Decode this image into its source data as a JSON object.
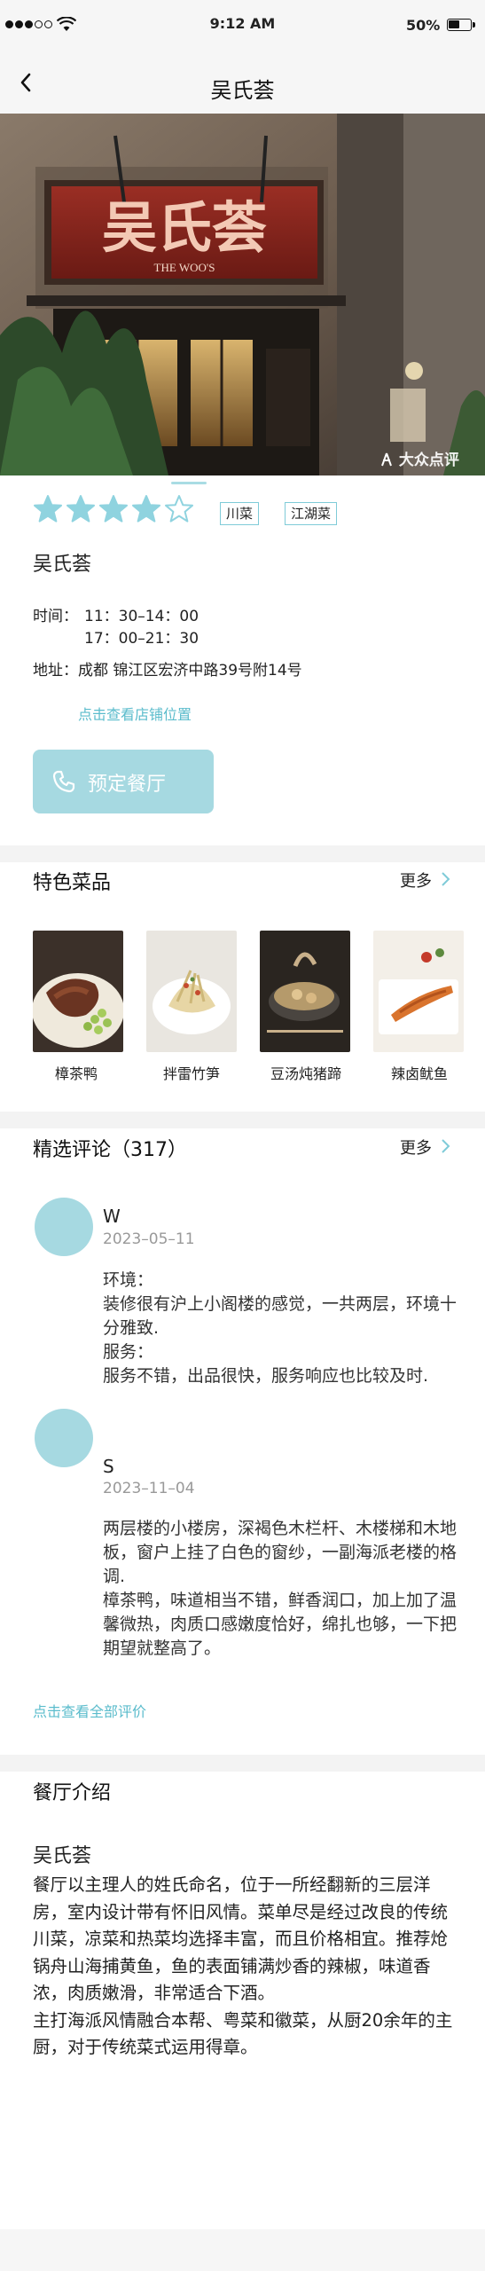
{
  "status_bar": {
    "time": "9:12 AM",
    "battery_percent": "50%",
    "battery_level": 0.5,
    "signal_bars_filled": 3,
    "signal_bars_total": 5
  },
  "nav": {
    "title": "吴氏荟",
    "back_icon": "chevron-left-icon"
  },
  "hero": {
    "watermark": "大众点评",
    "sign_text": "吴氏荟",
    "sign_sub": "THE WOO'S"
  },
  "rating": {
    "stars": 4,
    "max": 5,
    "color": "#8fd3df"
  },
  "tags": [
    "川菜",
    "江湖菜"
  ],
  "shop": {
    "name": "吴氏荟",
    "hours_label": "时间：",
    "hours": [
      "11：30–14：00",
      "17：00–21：30"
    ],
    "address_label": "地址：",
    "address": "成都 锦江区宏济中路39号附14号",
    "map_link": "点击查看店铺位置",
    "reserve_label": "预定餐厅"
  },
  "dishes": {
    "title": "特色菜品",
    "more": "更多",
    "items": [
      {
        "name": "樟茶鸭"
      },
      {
        "name": "拌雷竹笋"
      },
      {
        "name": "豆汤炖猪蹄"
      },
      {
        "name": "辣卤鱿鱼"
      }
    ]
  },
  "reviews": {
    "title": "精选评论（317）",
    "more": "更多",
    "items": [
      {
        "name": "W",
        "date": "2023–05–11",
        "lines": [
          "环境：",
          "装修很有沪上小阁楼的感觉，一共两层，环境十分雅致.",
          "服务：",
          "服务不错，出品很快，服务响应也比较及时."
        ]
      },
      {
        "name": "S",
        "date": "2023–11–04",
        "lines": [
          "两层楼的小楼房，深褐色木栏杆、木楼梯和木地板，窗户上挂了白色的窗纱，一副海派老楼的格调.",
          "樟茶鸭，味道相当不错，鲜香润口，加上加了温馨微热，肉质口感嫩度恰好，绵扎也够，一下把期望就整高了。"
        ]
      }
    ],
    "all_link": "点击查看全部评价"
  },
  "intro": {
    "title": "餐厅介绍",
    "name": "吴氏荟",
    "paragraphs": [
      "餐厅以主理人的姓氏命名，位于一所经翻新的三层洋房，室内设计带有怀旧风情。菜单尽是经过改良的传统川菜，凉菜和热菜均选择丰富，而且价格相宜。推荐炝锅舟山海捕黄鱼，鱼的表面铺满炒香的辣椒，味道香浓，肉质嫩滑，非常适合下酒。",
      "主打海派风情融合本帮、粤菜和徽菜，从厨20余年的主厨，对于传统菜式运用得章。"
    ]
  }
}
